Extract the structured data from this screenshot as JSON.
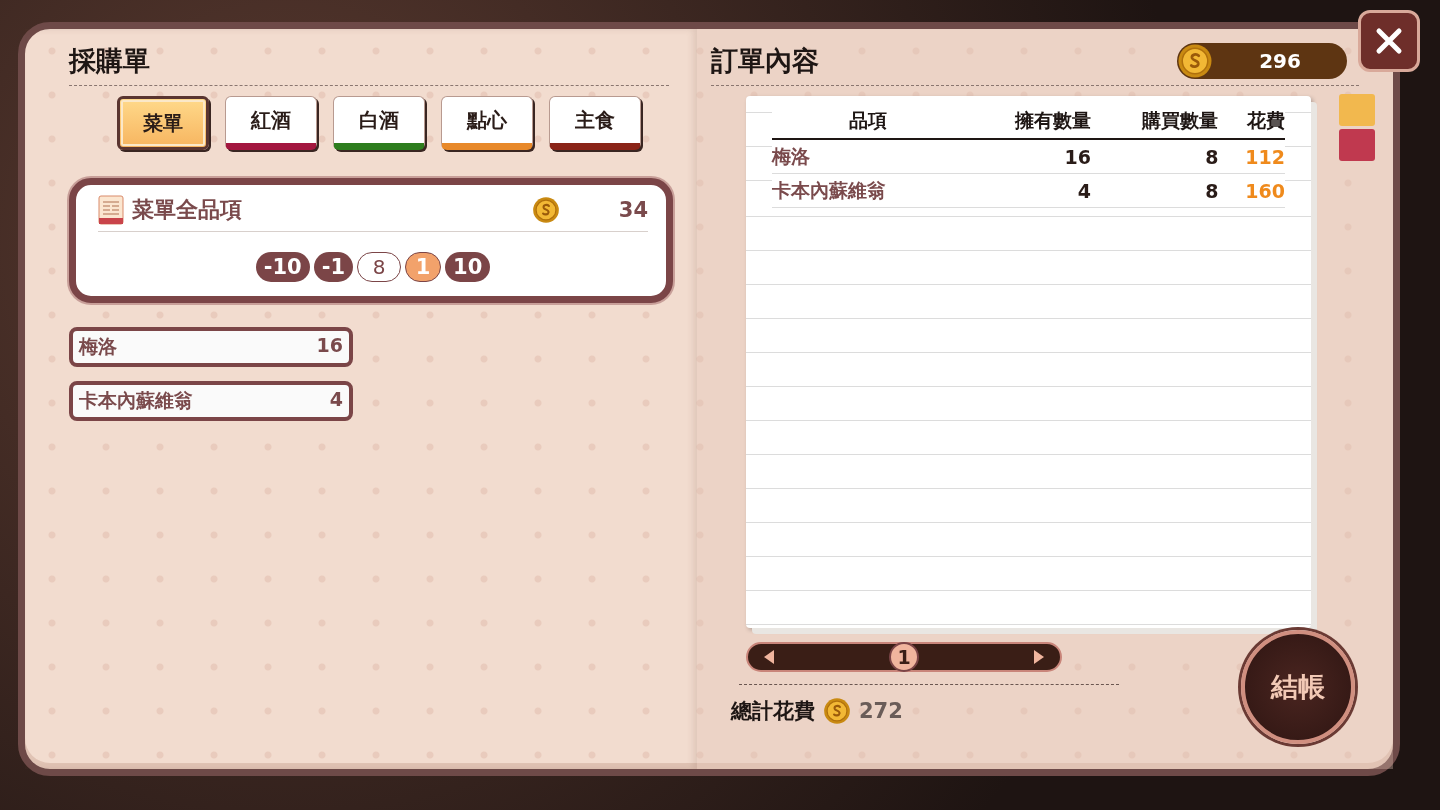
{
  "left_page": {
    "title": "採購單",
    "tabs": [
      {
        "label": "菜單",
        "selected": true,
        "color": "#5a3530"
      },
      {
        "label": "紅酒",
        "selected": false,
        "color": "#a3173f"
      },
      {
        "label": "白酒",
        "selected": false,
        "color": "#2e7d1e"
      },
      {
        "label": "點心",
        "selected": false,
        "color": "#e8892a"
      },
      {
        "label": "主食",
        "selected": false,
        "color": "#8a2418"
      }
    ],
    "selected_item": {
      "name": "菜單全品項",
      "price": "34",
      "controls": [
        {
          "kind": "step",
          "label": "-10",
          "selected": false
        },
        {
          "kind": "step",
          "label": "-1",
          "selected": false
        },
        {
          "kind": "value",
          "label": "8"
        },
        {
          "kind": "step",
          "label": "1",
          "selected": true
        },
        {
          "kind": "step",
          "label": "10",
          "selected": false
        }
      ]
    },
    "stock": [
      {
        "name": "梅洛",
        "count": "16"
      },
      {
        "name": "卡本內蘇維翁",
        "count": "4"
      }
    ]
  },
  "right_page": {
    "title": "訂單內容",
    "balance": "296",
    "table": {
      "columns": [
        "品項",
        "擁有數量",
        "購買數量",
        "花費"
      ],
      "rows": [
        [
          "梅洛",
          "16",
          "8",
          "112"
        ],
        [
          "卡本內蘇維翁",
          "4",
          "8",
          "160"
        ]
      ]
    },
    "pager": {
      "page": "1"
    },
    "total_label": "總計花費",
    "total": "272",
    "checkout": "結帳"
  }
}
